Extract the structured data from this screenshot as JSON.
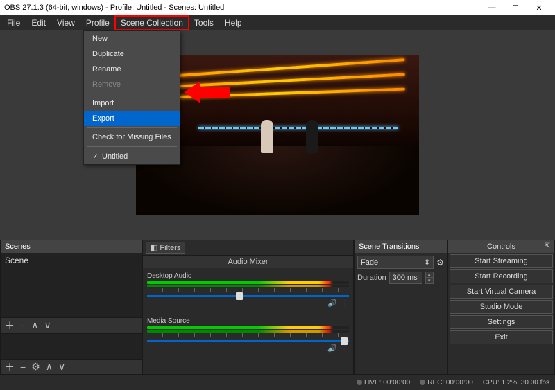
{
  "titlebar": {
    "title": "OBS 27.1.3 (64-bit, windows) - Profile: Untitled - Scenes: Untitled"
  },
  "menu": {
    "file": "File",
    "edit": "Edit",
    "view": "View",
    "profile": "Profile",
    "scene_collection": "Scene Collection",
    "tools": "Tools",
    "help": "Help"
  },
  "dropdown": {
    "new": "New",
    "duplicate": "Duplicate",
    "rename": "Rename",
    "remove": "Remove",
    "import": "Import",
    "export": "Export",
    "check_missing": "Check for Missing Files",
    "untitled": "Untitled"
  },
  "panels": {
    "scenes_hdr": "Scenes",
    "scene1": "Scene",
    "filters_btn": "Filters",
    "mixer_title": "Audio Mixer",
    "ch1": "Desktop Audio",
    "ch2": "Media Source",
    "transitions_hdr": "Scene Transitions",
    "trans_select": "Fade",
    "duration_label": "Duration",
    "duration_value": "300 ms",
    "controls_hdr": "Controls"
  },
  "controls": {
    "start_streaming": "Start Streaming",
    "start_recording": "Start Recording",
    "start_vcam": "Start Virtual Camera",
    "studio_mode": "Studio Mode",
    "settings": "Settings",
    "exit": "Exit"
  },
  "status": {
    "live": "LIVE: 00:00:00",
    "rec": "REC: 00:00:00",
    "cpu": "CPU: 1.2%, 30.00 fps"
  },
  "icons": {
    "plus": "＋",
    "minus": "−",
    "up": "∧",
    "down": "∨",
    "gear": "⚙",
    "vdots": "⋮",
    "speaker": "🔊",
    "updn": "⇕",
    "check": "✓"
  }
}
